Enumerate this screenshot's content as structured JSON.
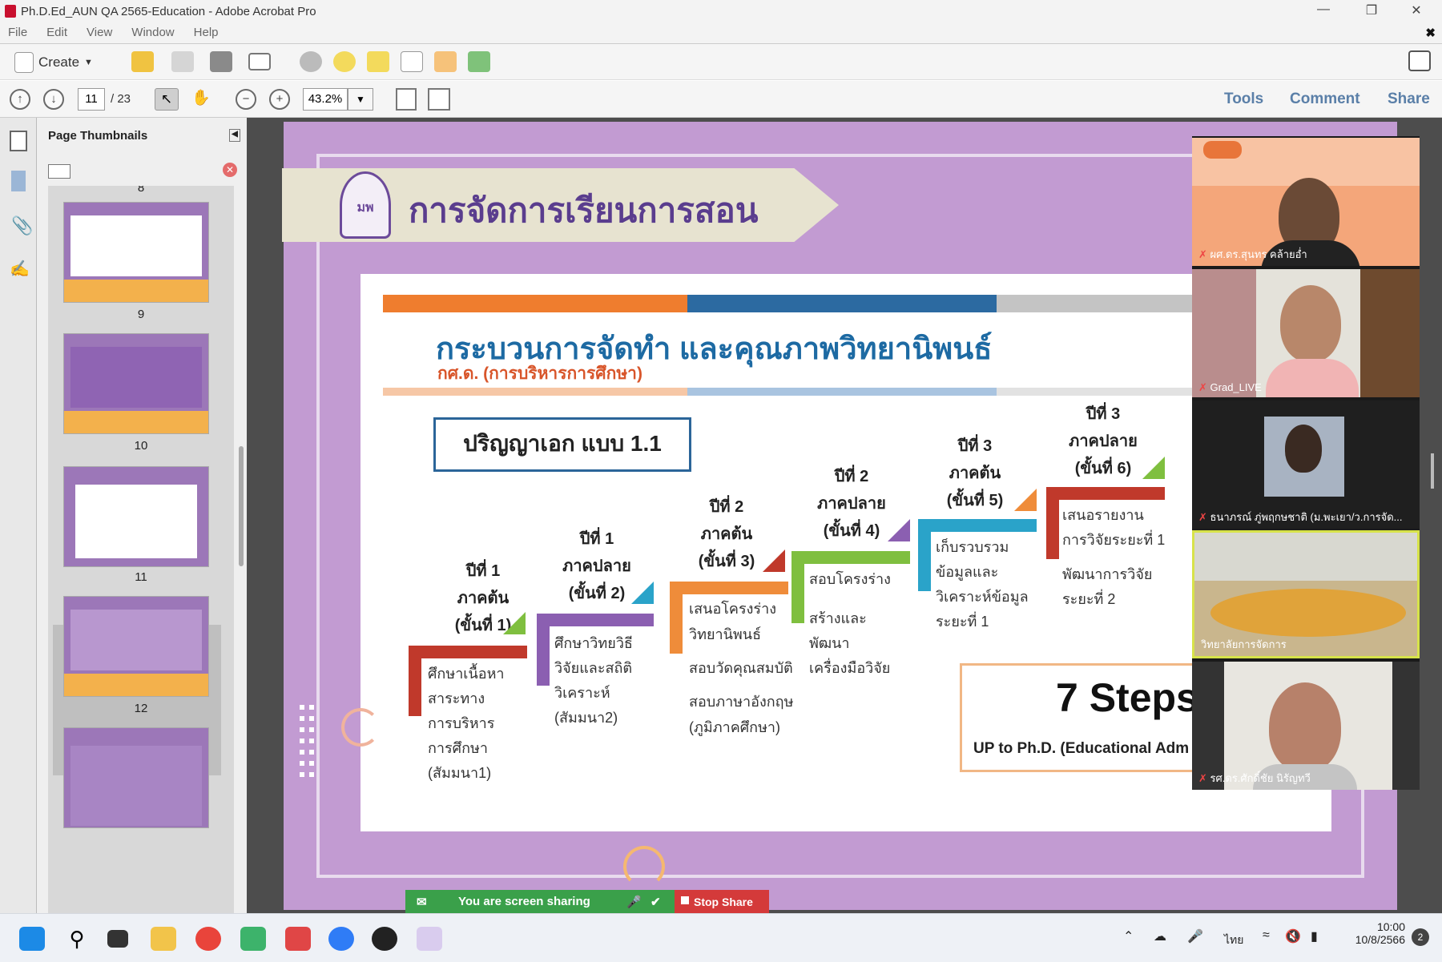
{
  "window": {
    "title": "Ph.D.Ed_AUN QA 2565-Education - Adobe Acrobat Pro"
  },
  "menu": [
    "File",
    "Edit",
    "View",
    "Window",
    "Help"
  ],
  "toolbar": {
    "create_label": "Create",
    "page_current": "11",
    "page_total": "/ 23",
    "zoom": "43.2%",
    "tools": "Tools",
    "comment": "Comment",
    "share": "Share"
  },
  "sidebar": {
    "title": "Page Thumbnails",
    "pages": [
      "8",
      "9",
      "10",
      "11",
      "12"
    ]
  },
  "slide": {
    "header_title": "การจัดการเรียนการสอน",
    "logo_text": "มพ",
    "card_title": "กระบวนการจัดทำ และคุณภาพวิทยานิพนธ์",
    "card_subtitle": "กศ.ด. (การบริหารการศึกษา)",
    "degree": "ปริญญาเอก  แบบ 1.1",
    "steps": [
      {
        "year": "ปีที่ 1",
        "term": "ภาคต้น",
        "step": "(ขั้นที่ 1)",
        "color": "#c0392b",
        "text": [
          "ศึกษาเนื้อหา",
          "สาระทาง",
          "การบริหาร",
          "การศึกษา",
          "(สัมมนา1)"
        ]
      },
      {
        "year": "ปีที่ 1",
        "term": "ภาคปลาย",
        "step": "(ขั้นที่ 2)",
        "color": "#8b5fb1",
        "text": [
          "ศึกษาวิทยวิธี",
          "วิจัยและสถิติ",
          "วิเคราะห์",
          "(สัมมนา2)"
        ]
      },
      {
        "year": "ปีที่ 2",
        "term": "ภาคต้น",
        "step": "(ขั้นที่ 3)",
        "color": "#ef8c3a",
        "text": [
          "เสนอโครงร่าง",
          "วิทยานิพนธ์",
          "สอบวัดคุณสมบัติ",
          "สอบภาษาอังกฤษ",
          "(ภูมิภาคศึกษา)"
        ]
      },
      {
        "year": "ปีที่ 2",
        "term": "ภาคปลาย",
        "step": "(ขั้นที่ 4)",
        "color": "#7fbf3f",
        "text": [
          "สอบโครงร่าง",
          "สร้างและ",
          "พัฒนา",
          "เครื่องมือวิจัย"
        ]
      },
      {
        "year": "ปีที่ 3",
        "term": "ภาคต้น",
        "step": "(ขั้นที่ 5)",
        "color": "#2aa3c9",
        "text": [
          "เก็บรวบรวม",
          "ข้อมูลและ",
          "วิเคราะห์ข้อมูล",
          "ระยะที่ 1"
        ]
      },
      {
        "year": "ปีที่ 3",
        "term": "ภาคปลาย",
        "step": "(ขั้นที่ 6)",
        "color": "#c0392b",
        "text": [
          "เสนอรายงาน",
          "การวิจัยระยะที่ 1",
          "พัฒนาการวิจัย",
          "ระยะที่ 2"
        ]
      }
    ],
    "steps_big": "7 Steps",
    "steps_sub": "UP to Ph.D. (Educational Adm"
  },
  "video": {
    "participants": [
      "ผศ.ดร.สุนทร คล้ายอ่ำ",
      "Grad_LIVE",
      "ธนาภรณ์ ภู่พฤกษชาติ (ม.พะเยา/ว.การจัด...",
      "วิทยาลัยการจัดการ",
      "รศ.ดร.ศักดิ์ชัย นิรัญทวี"
    ]
  },
  "screen_share": {
    "status": "You are screen sharing",
    "stop": "Stop Share"
  },
  "taskbar": {
    "lang": "ไทย",
    "time": "10:00",
    "date": "10/8/2566",
    "badge": "2"
  }
}
